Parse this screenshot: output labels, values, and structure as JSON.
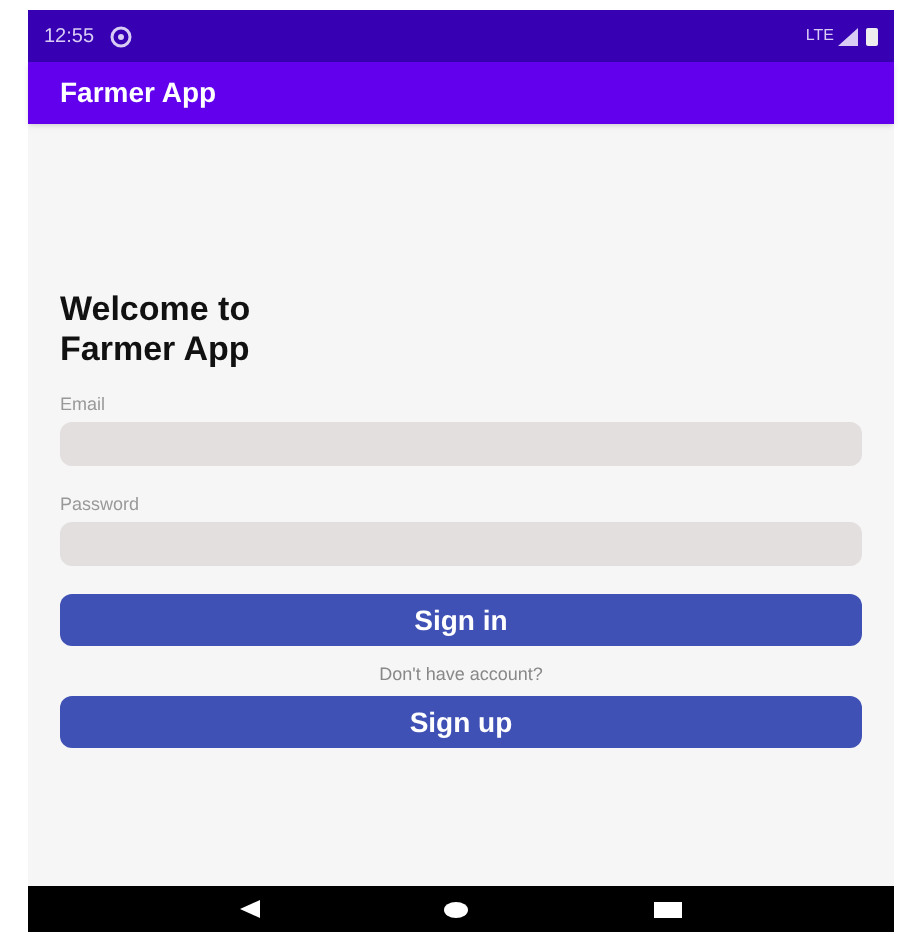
{
  "status_bar": {
    "time": "12:55",
    "network": "LTE"
  },
  "app_bar": {
    "title": "Farmer App"
  },
  "heading": "Welcome to\nFarmer App",
  "fields": [
    {
      "label": "Email"
    },
    {
      "label": "Password"
    }
  ],
  "sign_in_button": "Sign in",
  "prompt": "Don't have account?",
  "sign_up_button": "Sign up"
}
